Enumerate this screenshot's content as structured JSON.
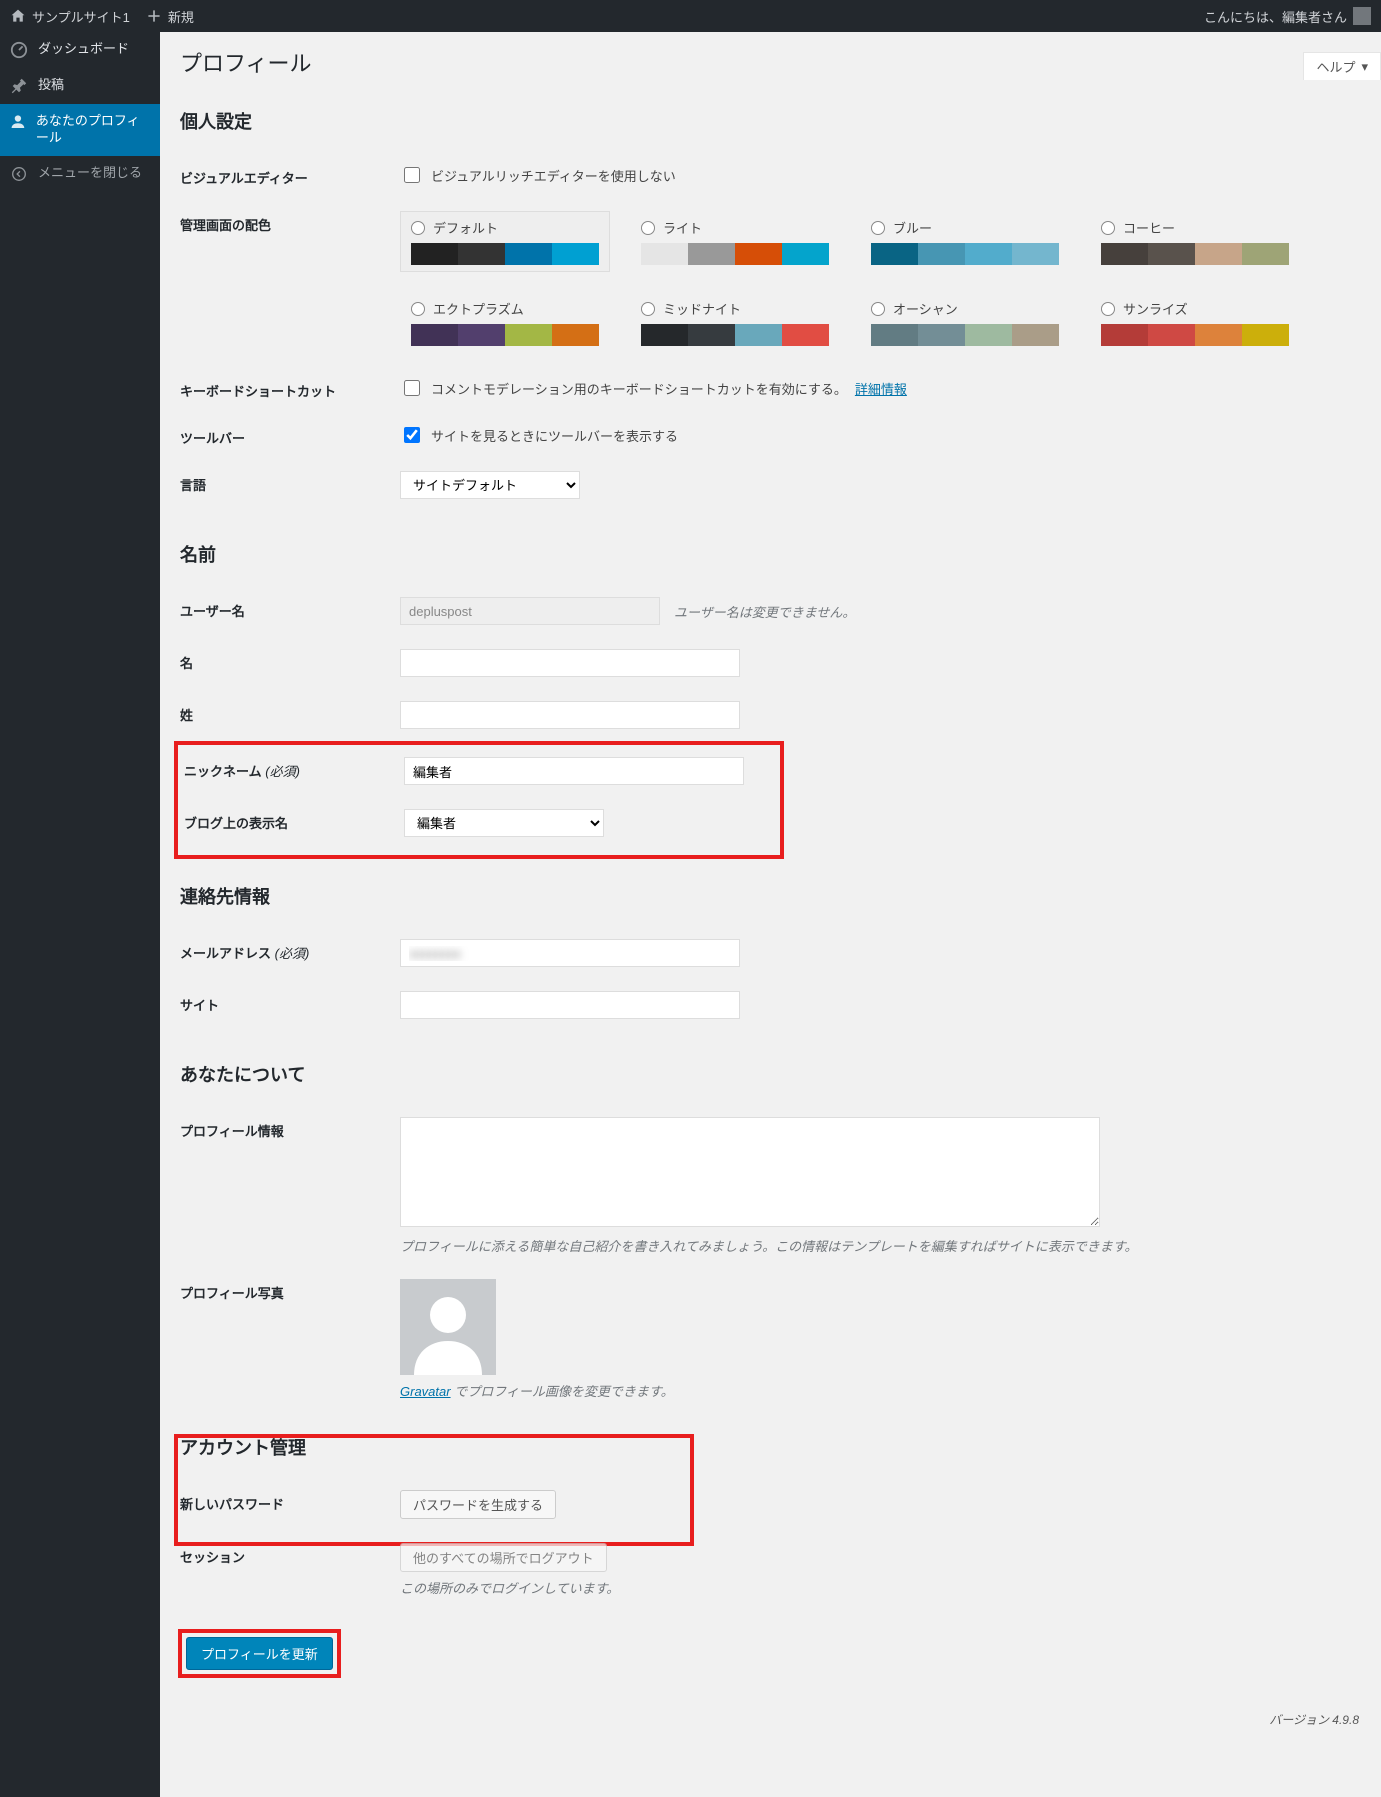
{
  "adminbar": {
    "site_name": "サンプルサイト1",
    "new_label": "新規",
    "greeting": "こんにちは、編集者さん"
  },
  "menu": {
    "dashboard": "ダッシュボード",
    "posts": "投稿",
    "profile": "あなたのプロフィール",
    "collapse": "メニューを閉じる"
  },
  "help": "ヘルプ",
  "page_title": "プロフィール",
  "sections": {
    "personal": "個人設定",
    "name": "名前",
    "contact": "連絡先情報",
    "about": "あなたについて",
    "account": "アカウント管理"
  },
  "labels": {
    "visual_editor": "ビジュアルエディター",
    "visual_editor_chk": "ビジュアルリッチエディターを使用しない",
    "color_scheme": "管理画面の配色",
    "kb_shortcut": "キーボードショートカット",
    "kb_shortcut_chk": "コメントモデレーション用のキーボードショートカットを有効にする。",
    "kb_more": "詳細情報",
    "toolbar": "ツールバー",
    "toolbar_chk": "サイトを見るときにツールバーを表示する",
    "language": "言語",
    "language_opt": "サイトデフォルト",
    "username": "ユーザー名",
    "username_val": "depluspost",
    "username_hint": "ユーザー名は変更できません。",
    "first": "名",
    "last": "姓",
    "nickname": "ニックネーム",
    "required": "(必須)",
    "nickname_val": "編集者",
    "display": "ブログ上の表示名",
    "display_opt": "編集者",
    "email": "メールアドレス",
    "site": "サイト",
    "bio": "プロフィール情報",
    "bio_hint": "プロフィールに添える簡単な自己紹介を書き入れてみましょう。この情報はテンプレートを編集すればサイトに表示できます。",
    "photo": "プロフィール写真",
    "gravatar": "Gravatar",
    "photo_hint": " でプロフィール画像を変更できます。",
    "newpw": "新しいパスワード",
    "newpw_btn": "パスワードを生成する",
    "sessions": "セッション",
    "sessions_btn": "他のすべての場所でログアウト",
    "sessions_hint": "この場所のみでログインしています。",
    "submit": "プロフィールを更新"
  },
  "schemes": [
    {
      "name": "デフォルト",
      "colors": [
        "#222",
        "#333",
        "#0073aa",
        "#00a0d2"
      ],
      "selected": true
    },
    {
      "name": "ライト",
      "colors": [
        "#e5e5e5",
        "#999",
        "#d64e07",
        "#04a4cc"
      ]
    },
    {
      "name": "ブルー",
      "colors": [
        "#096484",
        "#4796b3",
        "#52accc",
        "#74B6CE"
      ]
    },
    {
      "name": "コーヒー",
      "colors": [
        "#46403c",
        "#59524c",
        "#c7a589",
        "#9ea476"
      ]
    },
    {
      "name": "エクトプラズム",
      "colors": [
        "#413256",
        "#523f6d",
        "#a3b745",
        "#d46f15"
      ]
    },
    {
      "name": "ミッドナイト",
      "colors": [
        "#25282b",
        "#363b3f",
        "#69a8bb",
        "#e14d43"
      ]
    },
    {
      "name": "オーシャン",
      "colors": [
        "#627c83",
        "#738e96",
        "#9ebaa0",
        "#aa9d88"
      ]
    },
    {
      "name": "サンライズ",
      "colors": [
        "#b43c38",
        "#cf4944",
        "#dd823b",
        "#ccaf0b"
      ]
    }
  ],
  "footer": "バージョン 4.9.8"
}
